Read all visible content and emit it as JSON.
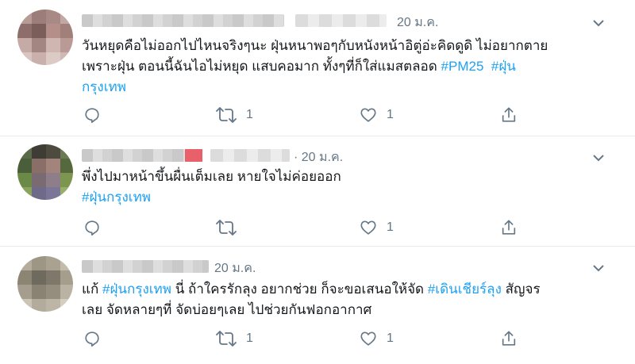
{
  "colors": {
    "link": "#1da1f2",
    "muted": "#657786",
    "divider": "#e6ecf0"
  },
  "tweets": [
    {
      "time": "20 ม.ค.",
      "text": "วันหยุดคือไม่ออกไปไหนจริงๆนะ ฝุ่นหนาพอๆกับหนังหน้าอิตู่อ่ะคิดดูดิ ไม่อยากตาย",
      "line2": "เพราะฝุ่น ตอนนี้ฉันไอไม่หยุด แสบคอมาก ทั้งๆที่ก็ใส่แมสตลอด",
      "tag1": "#PM25",
      "tag2a": "#ฝุ่น",
      "tag2b": "กรุงเทพ",
      "retweets": "1",
      "likes": "1"
    },
    {
      "time": "· 20 ม.ค.",
      "text": "พึ่งไปมาหน้าขึ้นผื่นเต็มเลย หายใจไม่ค่อยออก",
      "tag": "#ฝุ่นกรุงเทพ",
      "retweets": "",
      "likes": "1"
    },
    {
      "time": "20 ม.ค.",
      "pre": "แก้",
      "tag1": "#ฝุ่นกรุงเทพ",
      "mid": "นี่ ถ้าใครรักลุง อยากช่วย ก็จะขอเสนอให้จัด",
      "tag2": "#เดินเชียร์ลุง",
      "post": "สัญจร",
      "line2": "เลย จัดหลายๆที่ จัดบ่อยๆเลย ไปช่วยกันฟอกอากาศ",
      "retweets": "1",
      "likes": "1"
    }
  ],
  "icons": [
    "reply-icon",
    "retweet-icon",
    "like-icon",
    "share-icon",
    "chevron-down-icon"
  ]
}
